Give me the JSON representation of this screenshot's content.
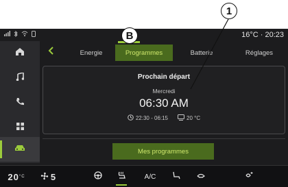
{
  "callouts": {
    "one": "1",
    "b": "B"
  },
  "status": {
    "clock": "16°C · 20:23"
  },
  "tabs": [
    {
      "label": "Energie"
    },
    {
      "label": "Programmes"
    },
    {
      "label": "Batterie"
    },
    {
      "label": "Réglages"
    }
  ],
  "active_tab": "Programmes",
  "card": {
    "title": "Prochain départ",
    "day": "Mercredi",
    "time": "06:30 AM",
    "range": "22:30 - 06:15",
    "temp": "20 °C"
  },
  "programs_button": "Mes programmes",
  "bottom": {
    "temp": "20",
    "temp_unit": "°C",
    "fan": "5",
    "ac": "A/C"
  },
  "colors": {
    "accent": "#9ccc3c",
    "active_bg": "#4a6b1e",
    "screen_bg": "#1c1c1e"
  }
}
